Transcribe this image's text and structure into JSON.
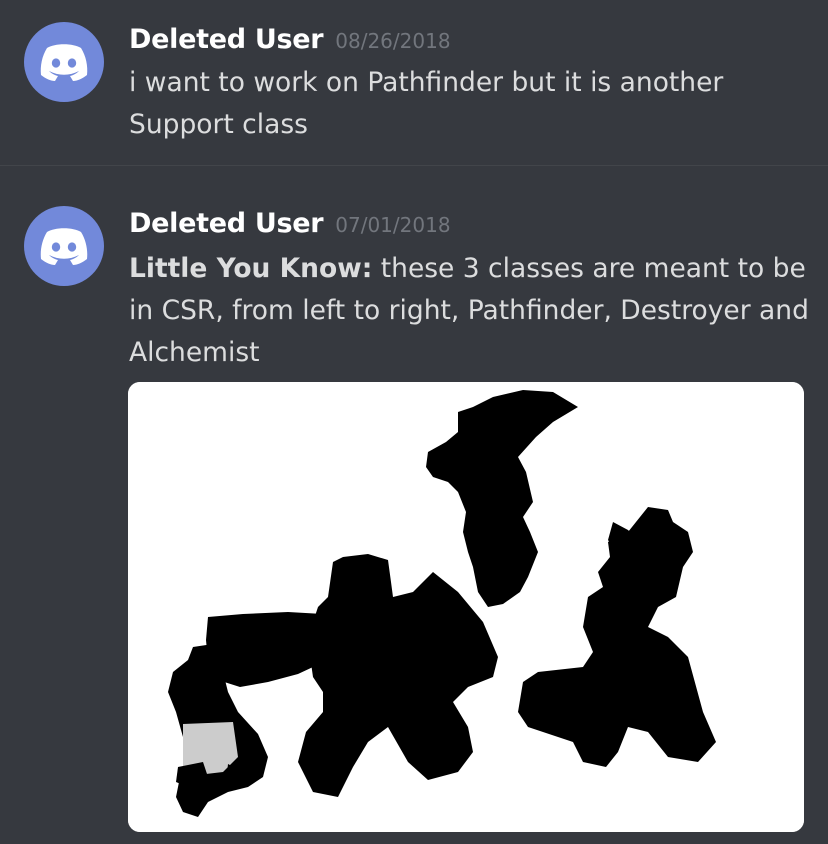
{
  "messages": [
    {
      "username": "Deleted User",
      "timestamp": "08/26/2018",
      "text": "i want to work on Pathfinder but it is another Support class"
    },
    {
      "username": "Deleted User",
      "timestamp": "07/01/2018",
      "bold_prefix": "Little You Know:",
      "text": " these 3 classes are meant to be in CSR, from left to right, Pathfinder, Destroyer and Alchemist",
      "attachment": {
        "icon": "silhouette-image",
        "colors": {
          "background": "#ffffff",
          "silhouette": "#000000",
          "accent": "#cccccc"
        }
      }
    }
  ],
  "colors": {
    "background": "#36393f",
    "avatar": "#7289da",
    "username": "#ffffff",
    "timestamp": "#72767d",
    "text": "#dcddde",
    "divider": "#42454a"
  },
  "icons": {
    "avatar": "discord-logo-icon"
  }
}
